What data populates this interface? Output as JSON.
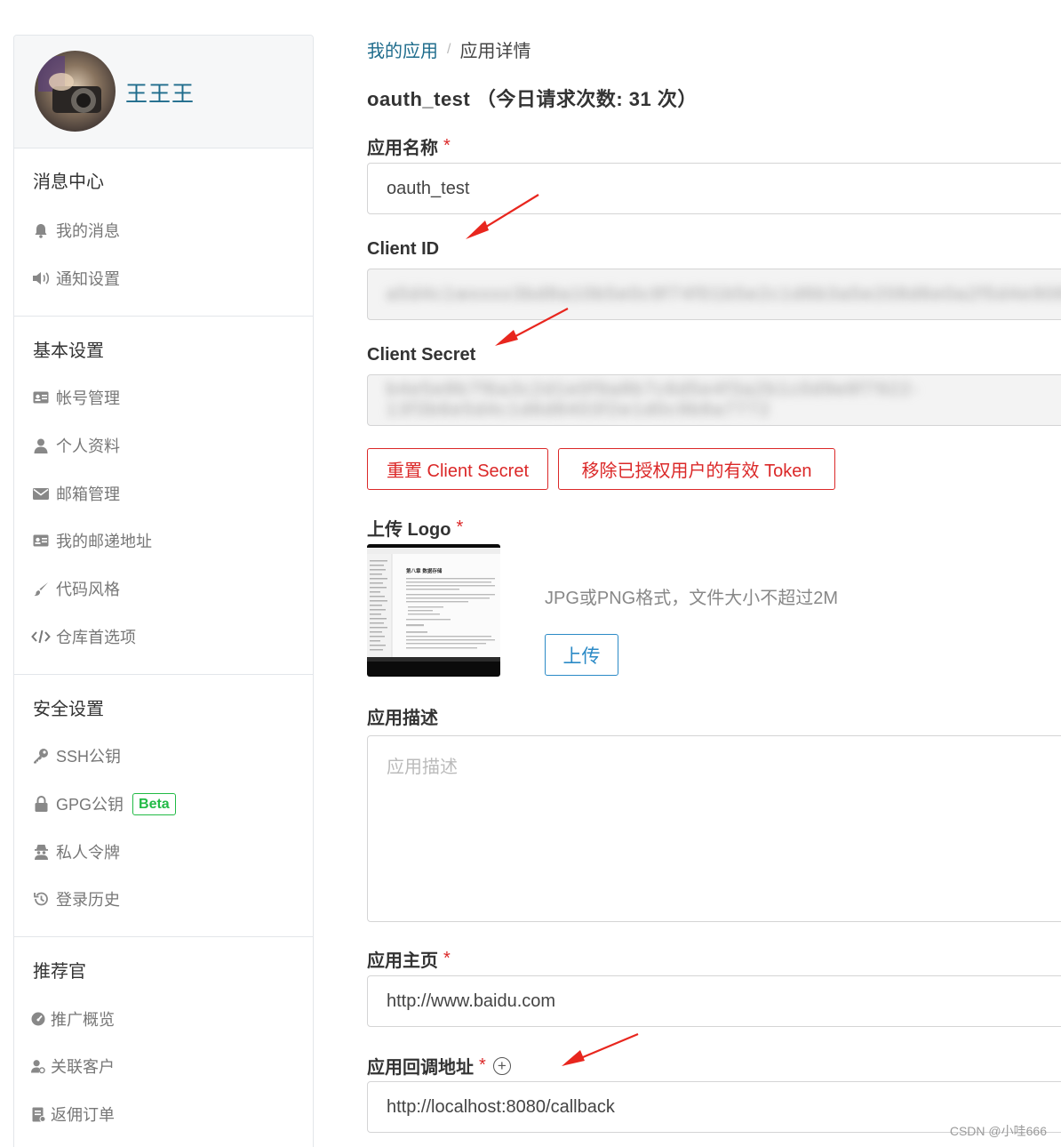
{
  "sidebar": {
    "username": "王王王",
    "sections": [
      {
        "title": "消息中心",
        "items": [
          {
            "label": "我的消息",
            "icon": "bell-icon"
          },
          {
            "label": "通知设置",
            "icon": "volume-icon"
          }
        ]
      },
      {
        "title": "基本设置",
        "items": [
          {
            "label": "帐号管理",
            "icon": "id-card-icon"
          },
          {
            "label": "个人资料",
            "icon": "user-icon"
          },
          {
            "label": "邮箱管理",
            "icon": "envelope-icon"
          },
          {
            "label": "我的邮递地址",
            "icon": "address-card-icon"
          },
          {
            "label": "代码风格",
            "icon": "paint-brush-icon"
          },
          {
            "label": "仓库首选项",
            "icon": "code-icon"
          }
        ]
      },
      {
        "title": "安全设置",
        "items": [
          {
            "label": "SSH公钥",
            "icon": "key-icon"
          },
          {
            "label": "GPG公钥",
            "icon": "lock-icon",
            "badge": "Beta"
          },
          {
            "label": "私人令牌",
            "icon": "user-secret-icon"
          },
          {
            "label": "登录历史",
            "icon": "history-icon"
          }
        ]
      },
      {
        "title": "推荐官",
        "items": [
          {
            "label": "推广概览",
            "icon": "dashboard-icon"
          },
          {
            "label": "关联客户",
            "icon": "user-link-icon"
          },
          {
            "label": "返佣订单",
            "icon": "order-icon"
          }
        ]
      }
    ]
  },
  "breadcrumb": {
    "parent": "我的应用",
    "separator": "/",
    "current": "应用详情"
  },
  "page_title": "oauth_test （今日请求次数: 31 次）",
  "form": {
    "app_name": {
      "label": "应用名称",
      "required": "*",
      "value": "oauth_test"
    },
    "client_id": {
      "label": "Client ID",
      "value": "a5d4c1wxxxx3bd8a10b5e0c9f74f01b5e2c1d6b3a5e208d6e0a2f5d4e9087"
    },
    "client_secret": {
      "label": "Client Secret",
      "value": "b4e5e8b7f6a3c2d1e0f9a8b7c6d5e4f3a2b1c0d9e8f7922-13f3b6e5d4c1d6d8403f2e1d0c9b8a7772"
    },
    "reset_secret_button": "重置 Client Secret",
    "revoke_tokens_button": "移除已授权用户的有效 Token",
    "logo": {
      "label": "上传 Logo",
      "required": "*",
      "hint": "JPG或PNG格式，文件大小不超过2M",
      "upload_button": "上传",
      "thumbnail_heading": "第八章 数据存储"
    },
    "description": {
      "label": "应用描述",
      "placeholder": "应用描述"
    },
    "homepage": {
      "label": "应用主页",
      "required": "*",
      "value": "http://www.baidu.com"
    },
    "callback": {
      "label": "应用回调地址",
      "required": "*",
      "value": "http://localhost:8080/callback"
    }
  },
  "watermark": "CSDN @小哇666",
  "colors": {
    "link": "#1f6c8c",
    "danger": "#db2828",
    "primary": "#2b8ac6",
    "success": "#21ba45",
    "annotation_arrow": "#e8261e"
  }
}
